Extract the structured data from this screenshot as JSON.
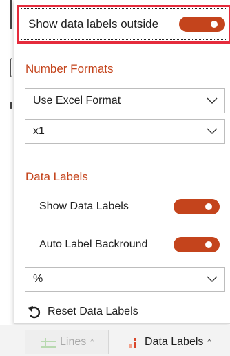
{
  "panel": {
    "show_outside": {
      "label": "Show data labels outside",
      "on": true
    },
    "number_formats": {
      "title": "Number Formats",
      "format_select": "Use Excel Format",
      "multiplier_select": "x1"
    },
    "data_labels": {
      "title": "Data Labels",
      "show_data_labels": {
        "label": "Show Data Labels",
        "on": true
      },
      "auto_label_background": {
        "label": "Auto Label Backround",
        "on": true
      },
      "suffix_select": "%",
      "reset_label": "Reset Data Labels"
    }
  },
  "ribbon": {
    "tabs": [
      {
        "label": "Lines",
        "caret": "^",
        "icon": "lines-icon",
        "disabled": true
      },
      {
        "label": "Data Labels",
        "caret": "^",
        "icon": "data-labels-icon",
        "disabled": false
      }
    ]
  },
  "colors": {
    "accent": "#c4441c",
    "highlight_border": "#e52b3c"
  }
}
